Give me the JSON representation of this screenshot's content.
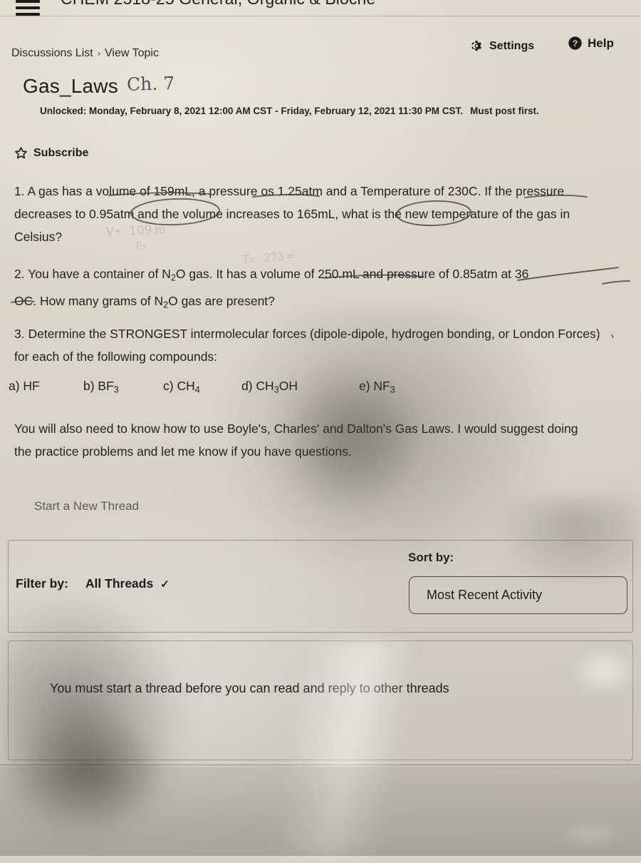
{
  "topbar": {
    "menu_icon": "hamburger-icon",
    "course_title": "CHEM 2518-25 General, Organic & Bioche",
    "chevron_icon": "chevron-down-icon"
  },
  "header": {
    "breadcrumb": {
      "parent": "Discussions List",
      "separator": "›",
      "current": "View Topic"
    },
    "settings_label": "Settings",
    "settings_icon": "gear-icon",
    "help_label": "Help",
    "help_icon": "question-circle-icon"
  },
  "topic": {
    "title": "Gas_Laws",
    "handwritten_note": "Ch. 7",
    "availability": "Unlocked: Monday, February 8, 2021 12:00 AM CST - Friday, February 12, 2021 11:30 PM CST.",
    "must_post_first": "Must post first.",
    "subscribe_label": "Subscribe",
    "subscribe_icon": "star-outline-icon"
  },
  "content": {
    "question_1": "1. A gas has a volume of 159mL, a pressure os 1.25atm and a Temperature of 230C. If the pressure decreases to 0.95atm and the volume increases to 165mL, what is the new temperature of the gas in Celsius?",
    "question_2_part_a": "2. You have a container of N",
    "question_2_sub_a": "2",
    "question_2_part_b": "O gas. It has a volume of 250.mL and pressure of 0.85atm at 36",
    "question_2_part_c": "OC. How many grams of N",
    "question_2_sub_b": "2",
    "question_2_part_d": "O gas are present?",
    "question_3": "3. Determine the STRONGEST intermolecular forces (dipole-dipole, hydrogen bonding, or London Forces) for each of the following compounds:",
    "compounds": [
      {
        "prefix": "a) HF",
        "base": "",
        "sub": "",
        "tail": ""
      },
      {
        "prefix": "b) BF",
        "base": "",
        "sub": "3",
        "tail": ""
      },
      {
        "prefix": "c) CH",
        "base": "",
        "sub": "4",
        "tail": ""
      },
      {
        "prefix": "d) CH",
        "base": "",
        "sub": "3",
        "tail": "OH"
      },
      {
        "prefix": "e) NF",
        "base": "",
        "sub": "3",
        "tail": ""
      }
    ],
    "closing_note": "You will also need to know how to use Boyle's, Charles' and Dalton's Gas Laws. I would suggest doing the practice problems and let me know if you have questions."
  },
  "threads": {
    "start_thread_label": "Start a New Thread",
    "filter_label": "Filter by:",
    "filter_value": "All Threads",
    "filter_chevron_icon": "chevron-down-icon",
    "sort_label": "Sort by:",
    "sort_value": "Most Recent Activity",
    "empty_message": "You must start a thread before you can read and reply to other threads"
  },
  "colors": {
    "page_background": "#d9d4c7",
    "text": "#232323",
    "muted_text": "#5d5b55",
    "border": "#4e4c46",
    "pen_ink": "#3b3a34"
  }
}
